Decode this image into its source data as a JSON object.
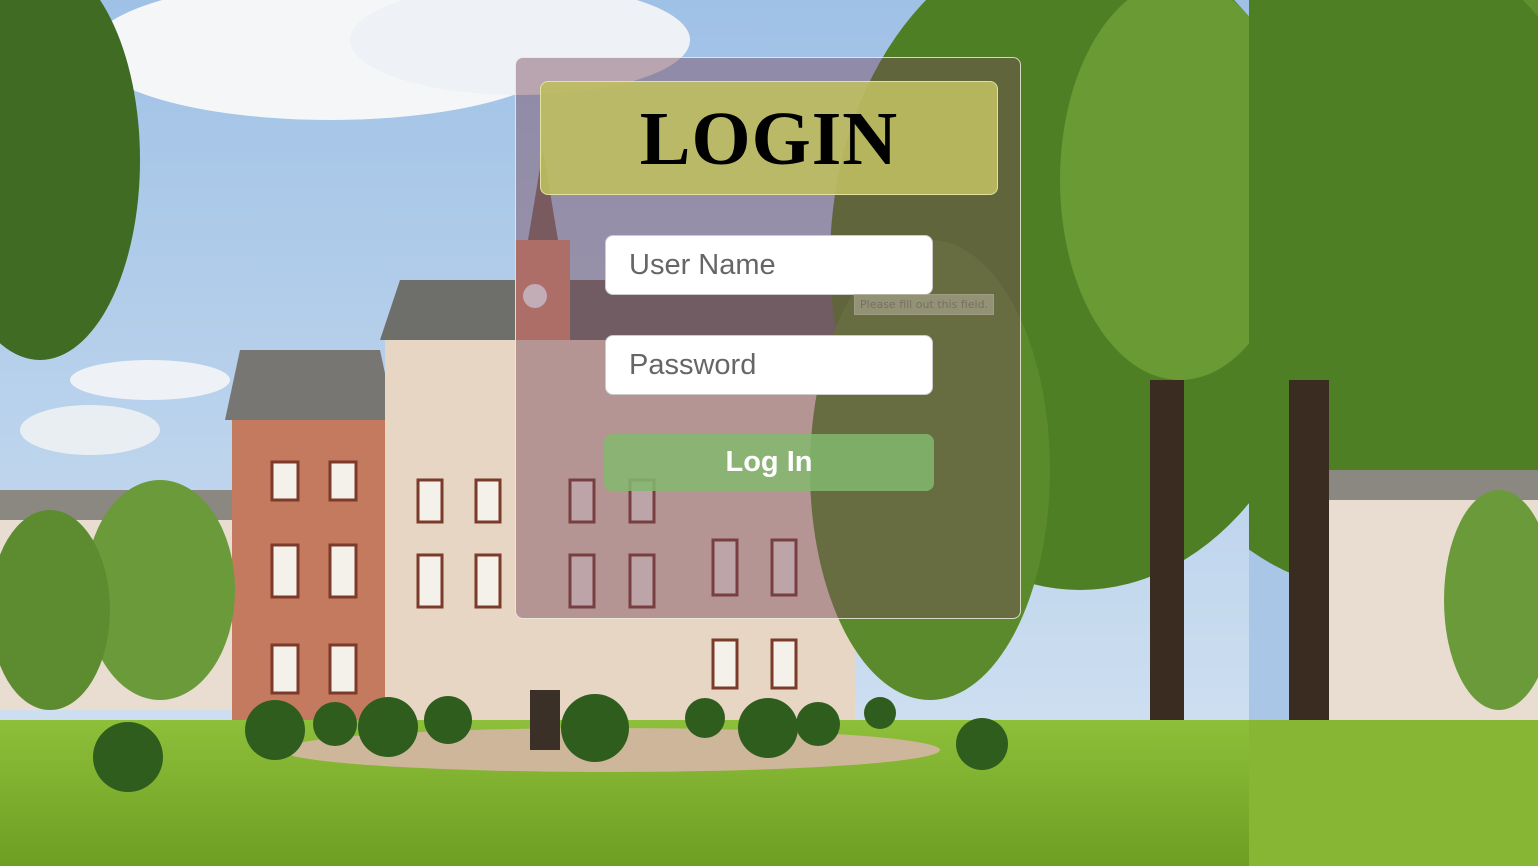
{
  "login": {
    "title": "LOGIN",
    "username_placeholder": "User Name",
    "password_placeholder": "Password",
    "tooltip": "Please fill out this field.",
    "button_label": "Log In"
  },
  "colors": {
    "panel_tint": "#784659",
    "header_bg": "#bebe5f",
    "button_bg": "#82b96e",
    "title_text": "#000000",
    "button_text": "#ffffff"
  }
}
